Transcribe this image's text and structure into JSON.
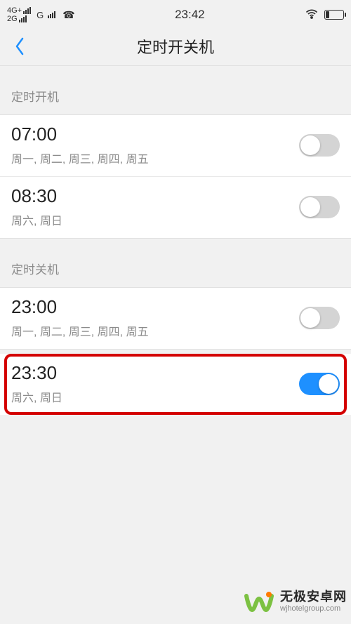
{
  "statusbar": {
    "net1_label": "4G+",
    "net2_label": "2G",
    "net3_label": "G",
    "time": "23:42"
  },
  "navbar": {
    "title": "定时开关机"
  },
  "sections": {
    "power_on": {
      "header": "定时开机",
      "rows": [
        {
          "time": "07:00",
          "days": "周一, 周二, 周三, 周四, 周五",
          "enabled": false
        },
        {
          "time": "08:30",
          "days": "周六, 周日",
          "enabled": false
        }
      ]
    },
    "power_off": {
      "header": "定时关机",
      "rows": [
        {
          "time": "23:00",
          "days": "周一, 周二, 周三, 周四, 周五",
          "enabled": false
        },
        {
          "time": "23:30",
          "days": "周六, 周日",
          "enabled": true
        }
      ]
    }
  },
  "watermark": {
    "title": "无极安卓网",
    "subtitle": "wjhotelgroup.com"
  }
}
